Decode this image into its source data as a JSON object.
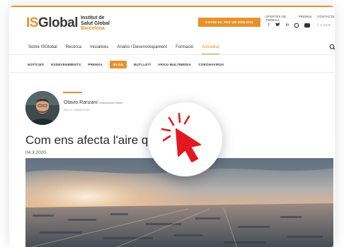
{
  "header": {
    "logo_is": "IS",
    "logo_global": "Global",
    "logo_line1": "Institut de",
    "logo_line2": "Salut Global",
    "logo_city": "Barcelona",
    "donate_label": "COVID-19: FES UN DONATIU",
    "util_links": [
      "OFERTES DE TREBALL",
      "PREMSA",
      "CONTACTE"
    ],
    "social_icons": [
      "facebook-icon",
      "twitter-icon",
      "linkedin-icon",
      "instagram-icon",
      "youtube-icon"
    ],
    "lang": "| ☺ CA ▾"
  },
  "main_nav": {
    "items": [
      "Sobre ISGlobal",
      "Recerca",
      "Iniciatives",
      "Anàlisi i Desenvolupament",
      "Formació",
      "Actualitat"
    ],
    "active": "Actualitat"
  },
  "sub_nav": {
    "items": [
      "NOTÍCIES",
      "ESDEVENIMENTS",
      "PREMSA",
      "BLOG",
      "BUTLLETÍ",
      "ARXIU MULTIMÈDIA",
      "CORONAVIRUS"
    ],
    "active": "BLOG"
  },
  "author": {
    "name": "Otavio Ranzani",
    "role": ", Postdoctoral Fellow",
    "area": "SALUT AMBIENTAL"
  },
  "article": {
    "title": "Com ens afecta l'aire qu",
    "date": "04.3.2020"
  },
  "colors": {
    "accent": "#e8912a",
    "cursor_red": "#e3191f"
  }
}
